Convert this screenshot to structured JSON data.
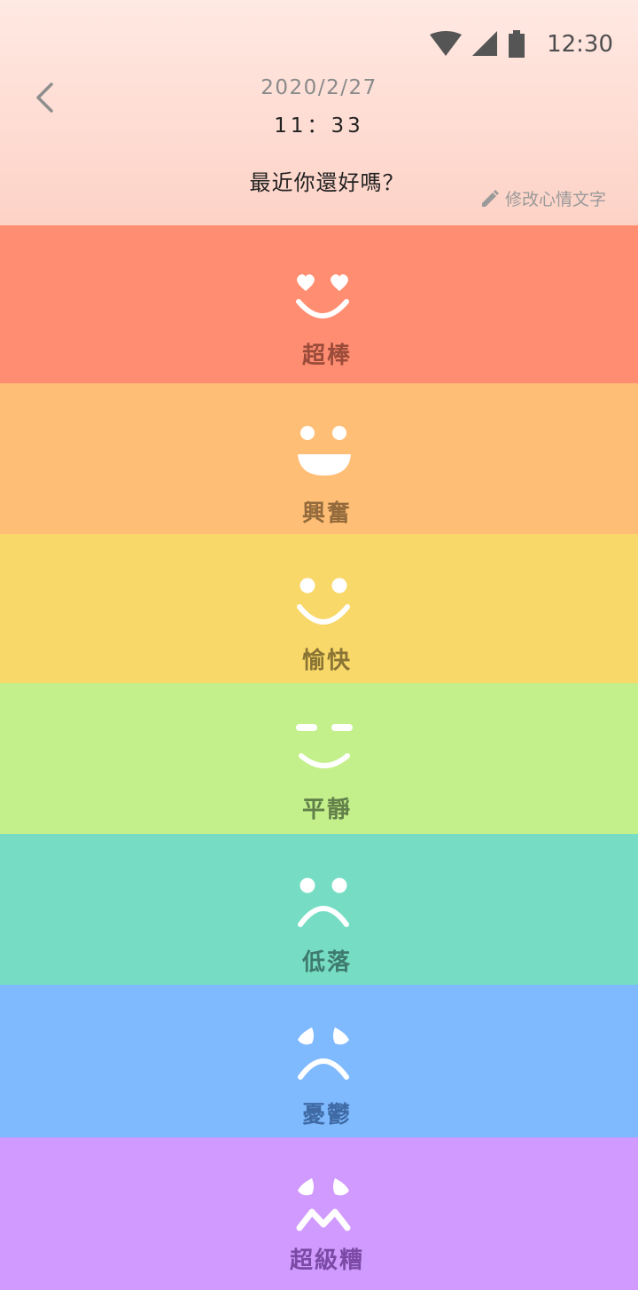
{
  "status_bar": {
    "time": "12:30",
    "icons": [
      "wifi-icon",
      "cell-signal-icon",
      "battery-icon"
    ]
  },
  "header": {
    "back_icon": "chevron-left-icon",
    "date": "2020/2/27",
    "time": "11：33",
    "question": "最近你還好嗎？",
    "edit_icon": "pencil-icon",
    "edit_label": "修改心情文字"
  },
  "moods": [
    {
      "label": "超棒",
      "face": "heart-eyes-smile-icon",
      "bg": "#ff8d71",
      "text_color": "#9a4b3a"
    },
    {
      "label": "興奮",
      "face": "big-grin-icon",
      "bg": "#ffbe75",
      "text_color": "#946b3c"
    },
    {
      "label": "愉快",
      "face": "smile-icon",
      "bg": "#f9d86a",
      "text_color": "#8a7434"
    },
    {
      "label": "平靜",
      "face": "calm-face-icon",
      "bg": "#c3f08a",
      "text_color": "#62804a"
    },
    {
      "label": "低落",
      "face": "frown-icon",
      "bg": "#76ddc4",
      "text_color": "#3e7a6e"
    },
    {
      "label": "憂鬱",
      "face": "worried-face-icon",
      "bg": "#7fbaff",
      "text_color": "#3f6aa4"
    },
    {
      "label": "超級糟",
      "face": "terrible-face-icon",
      "bg": "#d09aff",
      "text_color": "#7a4aa4"
    }
  ]
}
